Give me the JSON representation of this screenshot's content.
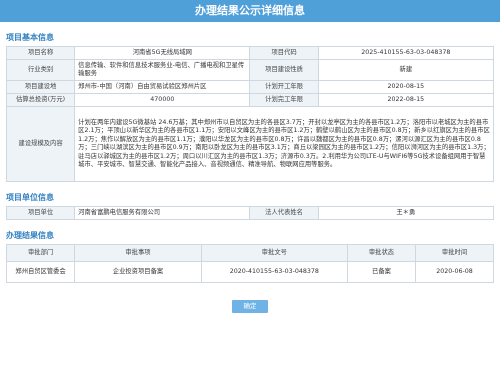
{
  "window": {
    "title": "办理结果公示详细信息"
  },
  "basic": {
    "section_title": "项目基本信息",
    "rows": [
      {
        "l1": "项目名称",
        "v1": "河南省5G无线局域网",
        "l2": "项目代码",
        "v2": "2025-410155-63-03-048378"
      },
      {
        "l1": "行业类别",
        "v1": "信息传输、软件和信息技术服务业-电信、广播电视和卫星传输服务",
        "l2": "项目建设性质",
        "v2": "新建"
      },
      {
        "l1": "项目建设地",
        "v1": "郑州市-中国（河南）自由贸易试验区郑州片区",
        "l2": "计划开工年限",
        "v2": "2020-08-15"
      },
      {
        "l1": "估算总投资(万元)",
        "v1": "470000",
        "l2": "计划完工年限",
        "v2": "2022-08-15"
      }
    ],
    "scale_label": "建设规模及内容",
    "scale_text": "计划在两年内建设5G微基站 24.6万基；其中郑州市以自贸区为主的各县区3.7万；开封以龙亭区为主的各县市区1.2万；洛阳市以老城区为主的县市区2.1万；平顶山以新华区为主的各县市区1.1万；安阳以文峰区为主的县市区1.2万；鹤壁以鹤山区为主的县市区0.8万；新乡以红旗区为主的县市区1.2万；焦作以解放区为主的县市区1.1万；濮阳以华龙区为主的县市区0.8万；许昌以魏都区为主的县市区0.8万；漯河以源汇区为主的县市区0.8万；三门峡以湖滨区为主的县市区0.9万；南阳以卧龙区为主的县市区3.1万；商丘以梁园区为主的县市区1.2万；信阳以浉河区为主的县市区1.3万；驻马店以驿城区为主的县市区1.2万；周口以川汇区为主的县市区1.3万；济源市0.3万。2.利用华为公司LTE-U与WIFI6等5G技术设备组网用于智慧城市、平安城市、智慧交通、智能化产品接入、音视频通信、精准导航、物联网应用等服务。"
  },
  "unit": {
    "section_title": "项目单位信息",
    "rows": [
      {
        "l1": "项目单位",
        "v1": "河南省富鹏电信服务有限公司",
        "l2": "法人代表姓名",
        "v2": "王＊勇"
      }
    ]
  },
  "result": {
    "section_title": "办理结果信息",
    "headers": [
      "审批部门",
      "审批事项",
      "审批文号",
      "审批状态",
      "审批时间"
    ],
    "rows": [
      [
        "郑州自贸区管委会",
        "企业投资项目备案",
        "2020-410155-63-03-048378",
        "已备案",
        "2020-06-08"
      ]
    ]
  },
  "buttons": {
    "ok": "确定"
  }
}
